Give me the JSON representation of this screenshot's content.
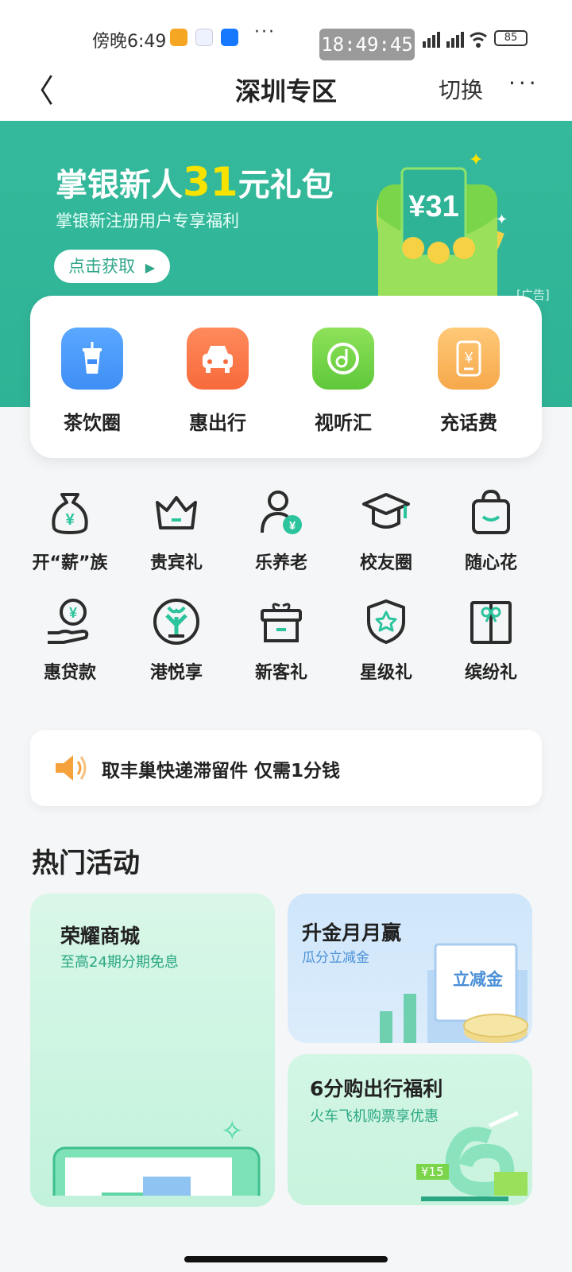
{
  "status_bar": {
    "time": "傍晚6:49",
    "dots": "···",
    "clock_overlay": "18:49:45",
    "battery": "85"
  },
  "nav": {
    "back_glyph": "〈",
    "title": "深圳专区",
    "switch_label": "切换",
    "more_glyph": "···"
  },
  "banner": {
    "title_prefix": "掌银新人",
    "title_highlight": "31",
    "title_suffix": "元礼包",
    "subtitle": "掌银新注册用户专享福利",
    "cta": "点击获取",
    "ad_tag": "[广告]",
    "envelope_amount": "¥31"
  },
  "quick_entries": [
    {
      "label": "茶饮圈",
      "icon": "cup-icon",
      "color": "#3f8ef5"
    },
    {
      "label": "惠出行",
      "icon": "car-icon",
      "color": "#f76a3c"
    },
    {
      "label": "视听汇",
      "icon": "music-icon",
      "color": "#6fd43a"
    },
    {
      "label": "充话费",
      "icon": "phone-bill-icon",
      "color": "#f6b55a"
    }
  ],
  "grid_row1": [
    {
      "label": "开“薪”族",
      "icon": "money-bag-icon"
    },
    {
      "label": "贵宾礼",
      "icon": "crown-icon"
    },
    {
      "label": "乐养老",
      "icon": "elder-person-icon"
    },
    {
      "label": "校友圈",
      "icon": "graduation-cap-icon"
    },
    {
      "label": "随心花",
      "icon": "shopping-bag-icon"
    }
  ],
  "grid_row2": [
    {
      "label": "惠贷款",
      "icon": "loan-hand-icon"
    },
    {
      "label": "港悦享",
      "icon": "bauhinia-icon"
    },
    {
      "label": "新客礼",
      "icon": "gift-box-icon"
    },
    {
      "label": "星级礼",
      "icon": "star-shield-icon"
    },
    {
      "label": "缤纷礼",
      "icon": "gift-card-icon"
    }
  ],
  "notice": {
    "text": "取丰巢快递滞留件 仅需1分钱",
    "icon": "speaker-icon"
  },
  "hot_section_title": "热门活动",
  "activities": [
    {
      "title": "荣耀商城",
      "subtitle": "至高24期分期免息"
    },
    {
      "title": "升金月月赢",
      "subtitle": "瓜分立减金",
      "badge": "立减金"
    },
    {
      "title": "6分购出行福利",
      "subtitle": "火车飞机购票享优惠",
      "tag": "¥15"
    }
  ],
  "colors": {
    "brand_green": "#2fb396",
    "accent_yellow": "#f8e300",
    "dark_green_icon": "#2c2c2c",
    "teal_icon": "#2bc49c"
  }
}
